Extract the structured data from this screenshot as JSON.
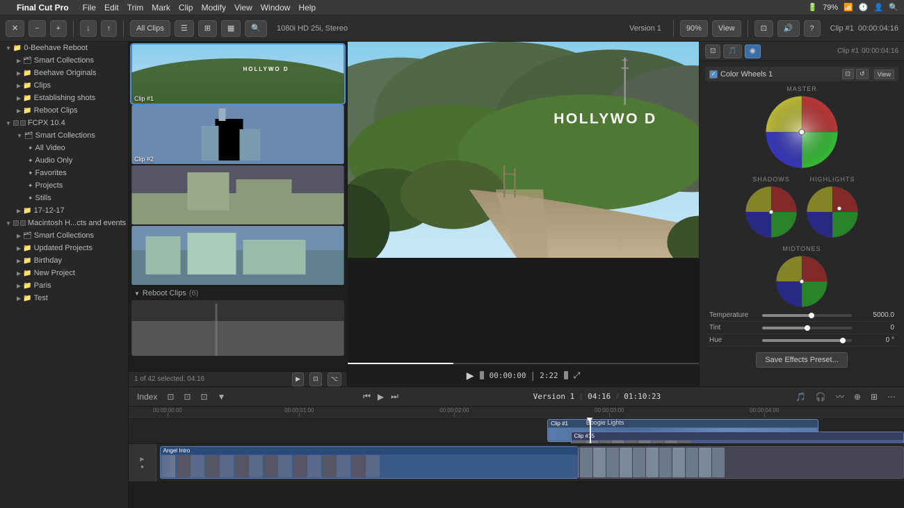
{
  "app": {
    "name": "Final Cut Pro",
    "menu_items": [
      "File",
      "Edit",
      "Trim",
      "Mark",
      "Clip",
      "Modify",
      "View",
      "Window",
      "Help"
    ]
  },
  "menubar": {
    "battery": "79%",
    "time": "system"
  },
  "toolbar": {
    "all_clips_label": "All Clips",
    "view_label": "View",
    "zoom_label": "90%",
    "clip_label": "1080i HD 25i, Stereo",
    "version_label": "Version 1",
    "clip_number": "Clip #1",
    "clip_time": "00:00:04:16"
  },
  "sidebar": {
    "items": [
      {
        "id": "beehave-reboot",
        "label": "0-Beehave Reboot",
        "indent": 0,
        "type": "folder",
        "expanded": true
      },
      {
        "id": "smart-collections-1",
        "label": "Smart Collections",
        "indent": 1,
        "type": "smart",
        "expanded": false
      },
      {
        "id": "beehave-originals",
        "label": "Beehave Originals",
        "indent": 1,
        "type": "folder",
        "expanded": false
      },
      {
        "id": "clips",
        "label": "Clips",
        "indent": 1,
        "type": "folder",
        "expanded": false
      },
      {
        "id": "establishing-shots",
        "label": "Establishing shots",
        "indent": 1,
        "type": "folder",
        "expanded": false
      },
      {
        "id": "reboot-clips",
        "label": "Reboot Clips",
        "indent": 1,
        "type": "folder",
        "expanded": false
      },
      {
        "id": "fcpx-104",
        "label": "FCPX 10.4",
        "indent": 0,
        "type": "folder",
        "expanded": true
      },
      {
        "id": "smart-collections-2",
        "label": "Smart Collections",
        "indent": 1,
        "type": "smart",
        "expanded": true
      },
      {
        "id": "all-video",
        "label": "All Video",
        "indent": 2,
        "type": "star"
      },
      {
        "id": "audio-only",
        "label": "Audio Only",
        "indent": 2,
        "type": "star"
      },
      {
        "id": "favorites",
        "label": "Favorites",
        "indent": 2,
        "type": "star"
      },
      {
        "id": "projects",
        "label": "Projects",
        "indent": 2,
        "type": "star"
      },
      {
        "id": "stills",
        "label": "Stills",
        "indent": 2,
        "type": "star"
      },
      {
        "id": "17-12-17",
        "label": "17-12-17",
        "indent": 1,
        "type": "folder",
        "expanded": false
      },
      {
        "id": "macintosh-hcts",
        "label": "Macintosh H...cts and events",
        "indent": 0,
        "type": "folder",
        "expanded": true
      },
      {
        "id": "smart-collections-3",
        "label": "Smart Collections",
        "indent": 1,
        "type": "smart",
        "expanded": false
      },
      {
        "id": "updated-projects",
        "label": "Updated Projects",
        "indent": 1,
        "type": "folder",
        "expanded": false
      },
      {
        "id": "birthday",
        "label": "Birthday",
        "indent": 1,
        "type": "folder",
        "expanded": false
      },
      {
        "id": "new-project",
        "label": "New Project",
        "indent": 1,
        "type": "folder",
        "expanded": false
      },
      {
        "id": "paris",
        "label": "Paris",
        "indent": 1,
        "type": "folder",
        "expanded": false
      },
      {
        "id": "test",
        "label": "Test",
        "indent": 1,
        "type": "folder",
        "expanded": false
      }
    ]
  },
  "clip_browser": {
    "clip1_label": "Clip #1",
    "clip2_label": "Clip #2",
    "reboot_clips_label": "Reboot Clips",
    "reboot_clips_count": "(6)",
    "footer_info": "1 of 42 selected, 04:16"
  },
  "inspector": {
    "effect_name": "Color Wheels 1",
    "clip_number": "Clip #1",
    "clip_time": "00:00:04:16",
    "view_label": "View",
    "section_master": "MASTER",
    "section_shadows": "SHADOWS",
    "section_highlights": "HIGHLIGHTS",
    "section_midtones": "MIDTONES",
    "temp_label": "Temperature",
    "temp_value": "5000.0",
    "tint_label": "Tint",
    "tint_value": "0",
    "hue_label": "Hue",
    "hue_value": "0 °",
    "save_effects_label": "Save Effects Preset..."
  },
  "preview": {
    "time_current": "00:00:00",
    "time_total": "2:22",
    "playhead_pos": "30"
  },
  "timeline": {
    "index_label": "Index",
    "version_label": "Version 1",
    "time_position": "04:16",
    "time_total": "01:10:23",
    "clip1_label": "Clip #1",
    "clip15_label": "Clip #15",
    "angel_intro_label": "Angel Intro",
    "boogie_lights_label": "Boogie Lights",
    "ruler_marks": [
      "00:00:00:00",
      "00:00:01:00",
      "00:00:02:00",
      "00:00:03:00",
      "00:00:04:00"
    ]
  }
}
